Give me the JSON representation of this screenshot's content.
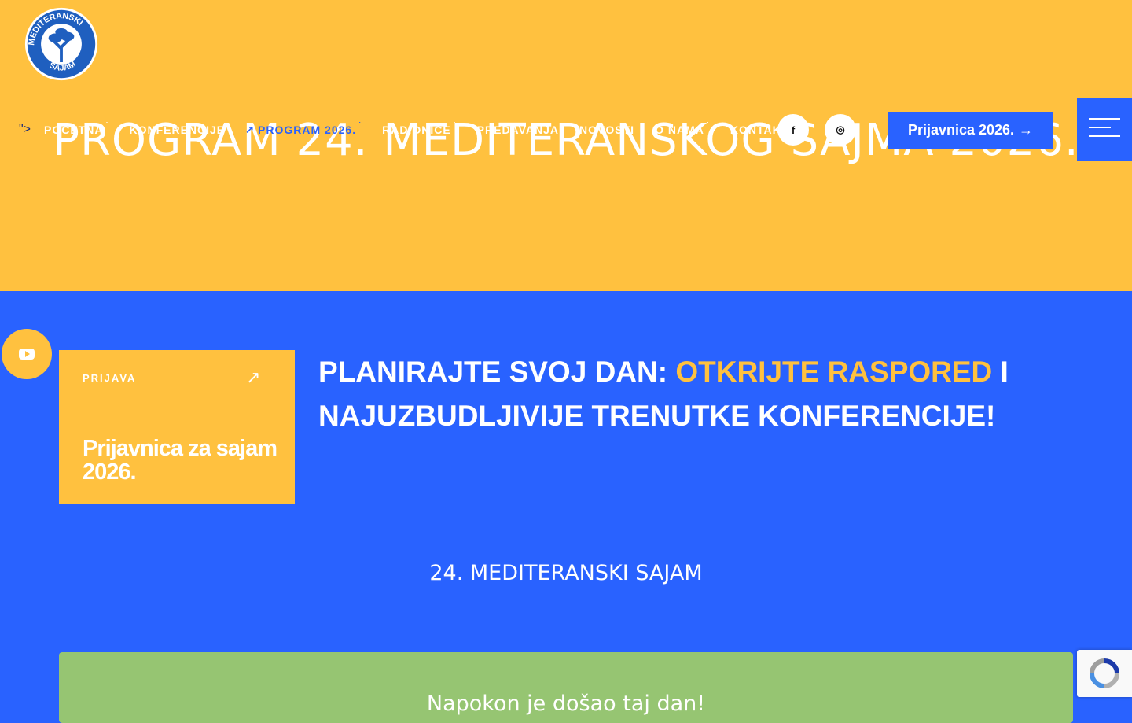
{
  "logo": {
    "text_top": "MEDITERANSKI",
    "text_bottom": "SAJAM",
    "icon": "olive-tree-logo"
  },
  "hero": {
    "title": "PROGRAM 24. MEDITERANSKOG SAJMA 2026."
  },
  "nav": {
    "bullet": "\">",
    "items": [
      {
        "label": "POČETNA",
        "caret": "˙"
      },
      {
        "label": "KONFERENCIJE",
        "caret": ""
      },
      {
        "label": "PROGRAM 2026.",
        "caret": "˙",
        "active": true
      },
      {
        "label": "RADIONICE",
        "caret": "˙"
      },
      {
        "label": "PREDAVANJA",
        "caret": ""
      },
      {
        "label": "NOVOSTI",
        "caret": ""
      },
      {
        "label": "O NAMA",
        "caret": "˙"
      },
      {
        "label": "KONTAKT",
        "caret": ""
      }
    ]
  },
  "social": {
    "facebook": "f",
    "instagram": "◎"
  },
  "cta": {
    "label": "Prijavnica 2026.",
    "arrow": "→"
  },
  "card": {
    "label": "PRIJAVA",
    "title": "Prijavnica za sajam 2026.",
    "arrow": "↗"
  },
  "headline": {
    "part1": "PLANIRAJTE SVOJ DAN: ",
    "highlight": "OTKRIJTE RASPORED",
    "part2": " I NAJUZBUDLJIVIJE TRENUTKE KONFERENCIJE!"
  },
  "subtitle": "24. MEDITERANSKI SAJAM",
  "green_box": {
    "text": "Napokon je došao taj dan!"
  },
  "colors": {
    "yellow": "#ffc13f",
    "blue": "#2962ff",
    "green": "#96c572"
  }
}
